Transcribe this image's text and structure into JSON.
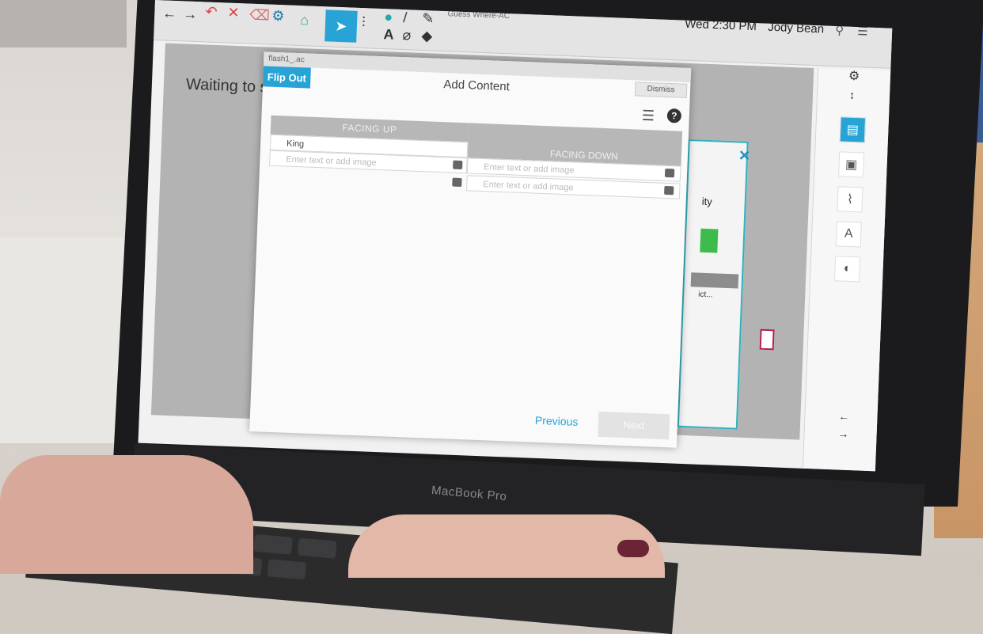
{
  "scene": {
    "laptop_brand": "MacBook Pro"
  },
  "app": {
    "menubar_title": "Guess Where-AC",
    "menubar_clock": "Wed 2:30 PM",
    "menubar_user": "Jody Bean",
    "canvas_text": "Waiting to st"
  },
  "dialog": {
    "titlebar": "flash1_.ac",
    "tab_label": "Flip Out",
    "title": "Add Content",
    "dismiss_label": "Dismiss",
    "help_glyph": "?",
    "columns": {
      "facing_up": "FACING UP",
      "facing_down": "FACING DOWN"
    },
    "rows": [
      {
        "up_value": "King",
        "down_placeholder": "Enter text or add image"
      },
      {
        "up_placeholder": "Enter text or add image",
        "down_placeholder": "Enter text or add image"
      }
    ],
    "previous_label": "Previous",
    "next_label": "Next"
  },
  "back_window": {
    "partial_text": "ity",
    "partial_text_2": "ict..."
  },
  "colors": {
    "accent": "#27a3d6",
    "close_x": "#1f8fc3",
    "green_tile": "#3dbb4c",
    "red_marker": "#b3204b"
  }
}
